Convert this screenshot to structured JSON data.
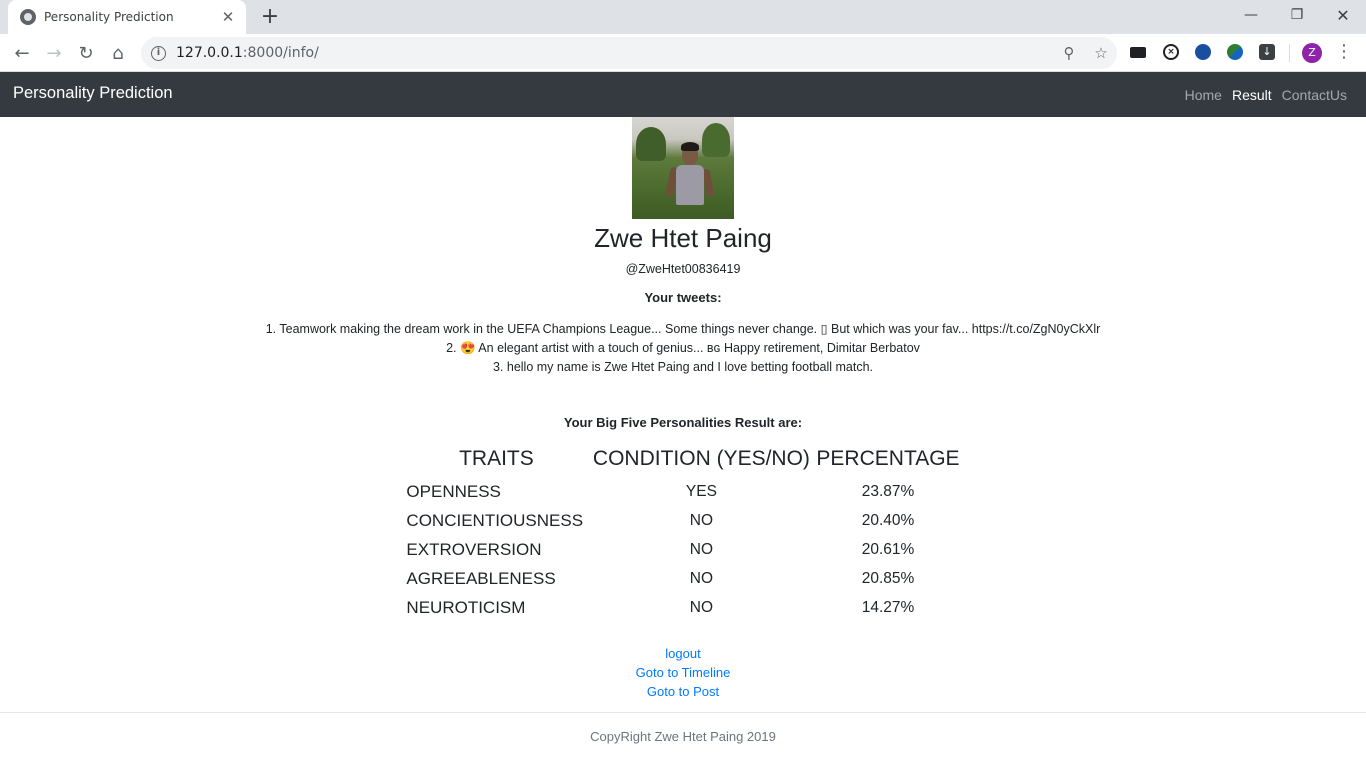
{
  "browser": {
    "tab_title": "Personality Prediction",
    "url_host": "127.0.0.1",
    "url_rest": ":8000/info/",
    "profile_initial": "Z"
  },
  "navbar": {
    "brand": "Personality Prediction",
    "links": [
      "Home",
      "Result",
      "ContactUs"
    ]
  },
  "profile": {
    "name": "Zwe Htet Paing",
    "handle": "@ZweHtet00836419"
  },
  "tweets_title": "Your tweets:",
  "tweets": [
    "1. Teamwork making the dream work in the UEFA Champions League... Some things never change. ▯ But which was your fav... https://t.co/ZgN0yCkXlr",
    "2. 😍 An elegant artist with a touch of genius... ʙɢ Happy retirement, Dimitar Berbatov",
    "3. hello my name is Zwe Htet Paing and I love betting football match."
  ],
  "result_title": "Your Big Five Personalities Result are:",
  "table": {
    "headers": [
      "TRAITS",
      "CONDITION (YES/NO)",
      "PERCENTAGE"
    ],
    "rows": [
      [
        "OPENNESS",
        "YES",
        "23.87%"
      ],
      [
        "CONCIENTIOUSNESS",
        "NO",
        "20.40%"
      ],
      [
        "EXTROVERSION",
        "NO",
        "20.61%"
      ],
      [
        "AGREEABLENESS",
        "NO",
        "20.85%"
      ],
      [
        "NEUROTICISM",
        "NO",
        "14.27%"
      ]
    ]
  },
  "links": [
    "logout",
    "Goto to Timeline",
    "Goto to Post"
  ],
  "footer": "CopyRight Zwe Htet Paing 2019"
}
